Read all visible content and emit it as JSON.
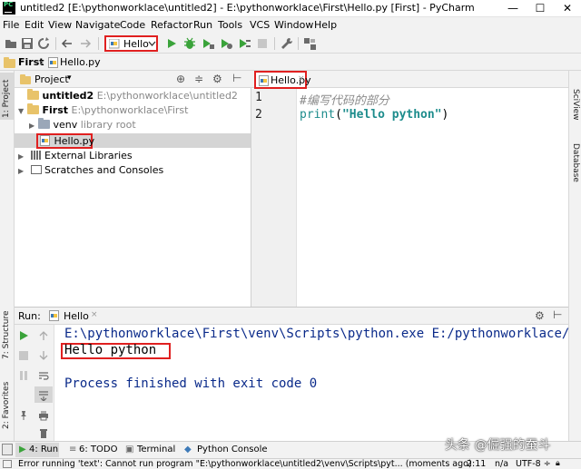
{
  "window": {
    "title": "untitled2 [E:\\pythonworklace\\untitled2] - E:\\pythonworklace\\First\\Hello.py [First] - PyCharm",
    "app_icon_text": "PC",
    "minimize": "—",
    "maximize": "☐",
    "close": "✕"
  },
  "menu": [
    "File",
    "Edit",
    "View",
    "Navigate",
    "Code",
    "Refactor",
    "Run",
    "Tools",
    "VCS",
    "Window",
    "Help"
  ],
  "toolbar": {
    "run_config": "Hello"
  },
  "navbar": {
    "crumbs": [
      "First",
      "Hello.py"
    ]
  },
  "left_strip": {
    "project_tab": "1: Project",
    "structure_tab": "7: Structure",
    "favorites_tab": "2: Favorites"
  },
  "right_strip": {
    "sciview_tab": "SciView",
    "database_tab": "Database"
  },
  "project": {
    "title": "Project",
    "rows": [
      {
        "name": "untitled2",
        "path": "E:\\pythonworklace\\untitled2"
      },
      {
        "name": "First",
        "path": "E:\\pythonworklace\\First"
      },
      {
        "name": "venv",
        "path": "library root"
      },
      {
        "name": "Hello.py",
        "path": ""
      },
      {
        "name": "External Libraries",
        "path": ""
      },
      {
        "name": "Scratches and Consoles",
        "path": ""
      }
    ]
  },
  "editor": {
    "tab_label": "Hello.py",
    "lines": [
      {
        "num": "1",
        "text": "#编写代码的部分"
      },
      {
        "num": "2",
        "fn": "print",
        "open": "(",
        "str": "\"Hello python\"",
        "close": ")"
      }
    ]
  },
  "run": {
    "label": "Run:",
    "config": "Hello",
    "output": [
      "E:\\pythonworklace\\First\\venv\\Scripts\\python.exe E:/pythonworklace/",
      "Hello python",
      "",
      "Process finished with exit code 0"
    ]
  },
  "bottom_tabs": [
    "4: Run",
    "6: TODO",
    "Terminal",
    "Python Console"
  ],
  "status": {
    "message": "Error running 'text': Cannot run program \"E:\\pythonworklace\\untitled2\\venv\\Scripts\\pyt... (moments ago)",
    "position": "2:11",
    "line_sep": "n/a",
    "encoding": "UTF-8 ÷"
  },
  "watermark": "头条 @倔强的蚕斗",
  "colors": {
    "highlight": "#e02020",
    "console_text": "#0a2a8a",
    "comment": "#8c8c8c",
    "keyword_teal": "#1d8c8c",
    "string_green": "#067d17"
  }
}
